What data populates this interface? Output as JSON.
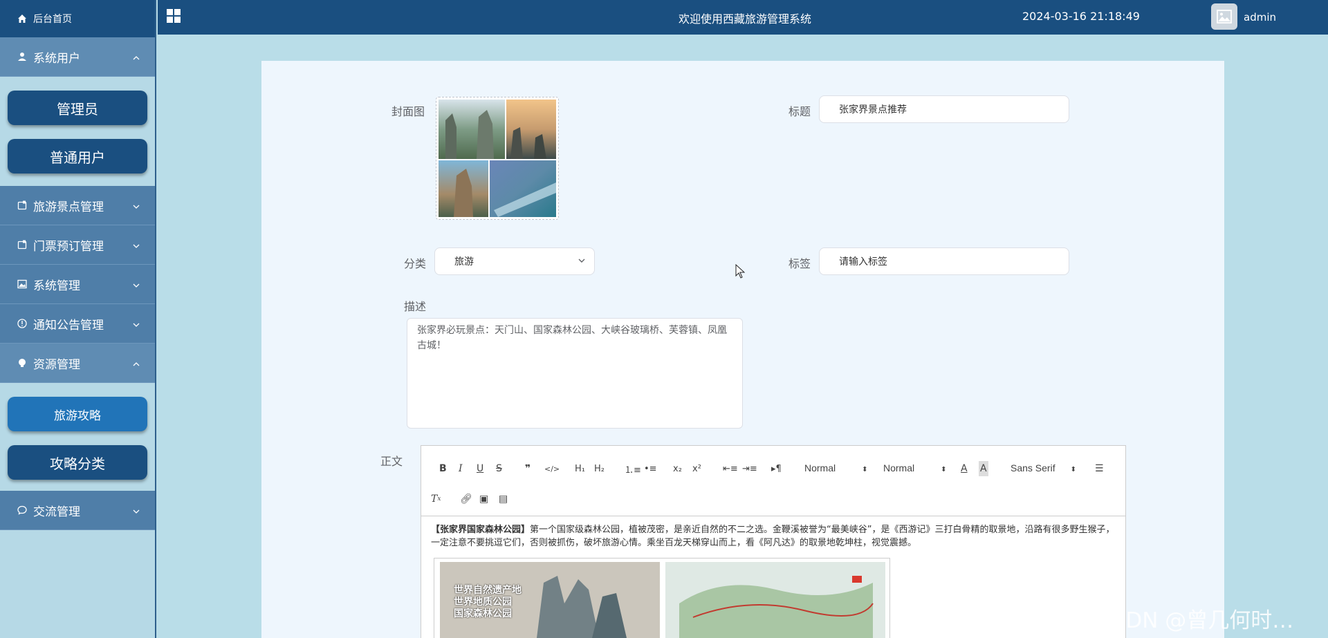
{
  "sidebar": {
    "home": "后台首页",
    "groups": {
      "users": "系统用户",
      "attractions": "旅游景点管理",
      "tickets": "门票预订管理",
      "system": "系统管理",
      "notices": "通知公告管理",
      "resources": "资源管理",
      "communication": "交流管理"
    },
    "user_items": [
      "管理员",
      "普通用户"
    ],
    "resource_items": [
      "旅游攻略",
      "攻略分类"
    ]
  },
  "header": {
    "title": "欢迎使用西藏旅游管理系统",
    "datetime": "2024-03-16 21:18:49",
    "username": "admin"
  },
  "form": {
    "cover_label": "封面图",
    "title_label": "标题",
    "title_value": "张家界景点推荐",
    "category_label": "分类",
    "category_value": "旅游",
    "tag_label": "标签",
    "tag_placeholder": "请输入标签",
    "description_label": "描述",
    "description_value": "张家界必玩景点：天门山、国家森林公园、大峡谷玻璃桥、芙蓉镇、凤凰古城！",
    "content_label": "正文"
  },
  "editor": {
    "header_select": "Normal",
    "size_select": "Normal",
    "font_select": "Sans Serif",
    "content_bold": "【张家界国家森林公园】",
    "content_text": "第一个国家级森林公园，植被茂密，是亲近自然的不二之选。金鞭溪被誉为“最美峡谷”，是《西游记》三打白骨精的取景地，沿路有很多野生猴子，一定注意不要挑逗它们，否则被抓伤，破坏旅游心情。乘坐百龙天梯穿山而上，看《阿凡达》的取景地乾坤柱，视觉震撼。",
    "image_caption_lines": [
      "世界自然遗产地",
      "世界地质公园",
      "国家森林公园"
    ]
  },
  "watermark": "CSDN @曾几何时…",
  "colors": {
    "header": "#1a4f80",
    "sidebar_group": "#4f7ea8",
    "active_item": "#2174b8",
    "page_bg": "#b9dde8",
    "panel_bg": "#eef6fd"
  }
}
